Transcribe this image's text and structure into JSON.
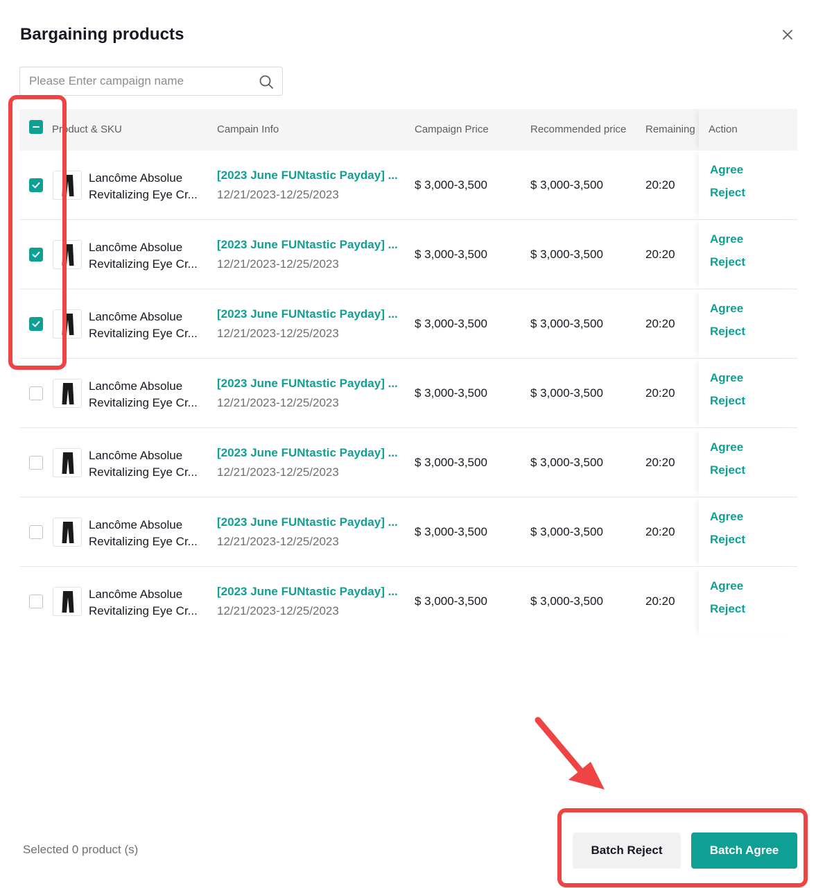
{
  "modal": {
    "title": "Bargaining products",
    "close_icon": "close-icon"
  },
  "search": {
    "placeholder": "Please Enter campaign name",
    "value": "",
    "icon": "search-icon"
  },
  "table": {
    "headers": {
      "product": "Product & SKU",
      "campaign": "Campain Info",
      "campaign_price": "Campaign Price",
      "recommended_price": "Recommended price",
      "remaining": "Remaining time",
      "action": "Action"
    },
    "header_checkbox_state": "indeterminate",
    "rows": [
      {
        "checked": true,
        "product_line1": "Lancôme Absolue",
        "product_line2": "Revitalizing Eye Cr...",
        "campaign_name": "[2023 June FUNtastic Payday] ...",
        "campaign_date": "12/21/2023-12/25/2023",
        "campaign_price": "$ 3,000-3,500",
        "recommended_price": "$ 3,000-3,500",
        "remaining": "20:20",
        "agree": "Agree",
        "reject": "Reject"
      },
      {
        "checked": true,
        "product_line1": "Lancôme Absolue",
        "product_line2": "Revitalizing Eye Cr...",
        "campaign_name": "[2023 June FUNtastic Payday] ...",
        "campaign_date": "12/21/2023-12/25/2023",
        "campaign_price": "$ 3,000-3,500",
        "recommended_price": "$ 3,000-3,500",
        "remaining": "20:20",
        "agree": "Agree",
        "reject": "Reject"
      },
      {
        "checked": true,
        "product_line1": "Lancôme Absolue",
        "product_line2": "Revitalizing Eye Cr...",
        "campaign_name": "[2023 June FUNtastic Payday] ...",
        "campaign_date": "12/21/2023-12/25/2023",
        "campaign_price": "$ 3,000-3,500",
        "recommended_price": "$ 3,000-3,500",
        "remaining": "20:20",
        "agree": "Agree",
        "reject": "Reject"
      },
      {
        "checked": false,
        "product_line1": "Lancôme Absolue",
        "product_line2": "Revitalizing Eye Cr...",
        "campaign_name": "[2023 June FUNtastic Payday] ...",
        "campaign_date": "12/21/2023-12/25/2023",
        "campaign_price": "$ 3,000-3,500",
        "recommended_price": "$ 3,000-3,500",
        "remaining": "20:20",
        "agree": "Agree",
        "reject": "Reject"
      },
      {
        "checked": false,
        "product_line1": "Lancôme Absolue",
        "product_line2": "Revitalizing Eye Cr...",
        "campaign_name": "[2023 June FUNtastic Payday] ...",
        "campaign_date": "12/21/2023-12/25/2023",
        "campaign_price": "$ 3,000-3,500",
        "recommended_price": "$ 3,000-3,500",
        "remaining": "20:20",
        "agree": "Agree",
        "reject": "Reject"
      },
      {
        "checked": false,
        "product_line1": "Lancôme Absolue",
        "product_line2": "Revitalizing Eye Cr...",
        "campaign_name": "[2023 June FUNtastic Payday] ...",
        "campaign_date": "12/21/2023-12/25/2023",
        "campaign_price": "$ 3,000-3,500",
        "recommended_price": "$ 3,000-3,500",
        "remaining": "20:20",
        "agree": "Agree",
        "reject": "Reject"
      },
      {
        "checked": false,
        "product_line1": "Lancôme Absolue",
        "product_line2": "Revitalizing Eye Cr...",
        "campaign_name": "[2023 June FUNtastic Payday] ...",
        "campaign_date": "12/21/2023-12/25/2023",
        "campaign_price": "$ 3,000-3,500",
        "recommended_price": "$ 3,000-3,500",
        "remaining": "20:20",
        "agree": "Agree",
        "reject": "Reject"
      }
    ]
  },
  "footer": {
    "selected_text": "Selected 0 product (s)",
    "batch_reject": "Batch Reject",
    "batch_agree": "Batch Agree"
  },
  "colors": {
    "accent": "#0e9f95",
    "highlight": "#ef4444"
  }
}
